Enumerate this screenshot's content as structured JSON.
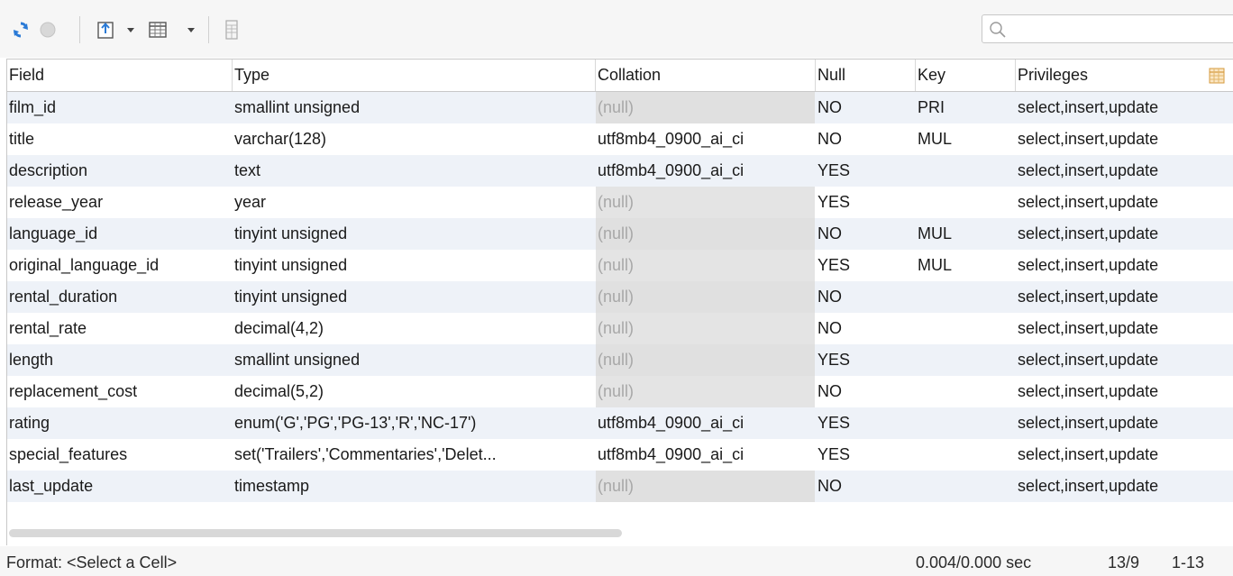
{
  "toolbar": {
    "search_placeholder": "",
    "icons": [
      "refresh-icon",
      "stop-icon",
      "export-icon",
      "dropdown-arrow-icon",
      "grid-view-icon",
      "dropdown-arrow-icon",
      "form-view-icon",
      "search-icon",
      "column-chooser-icon"
    ]
  },
  "grid": {
    "columns": [
      "Field",
      "Type",
      "Collation",
      "Null",
      "Key",
      "Privileges"
    ],
    "rows": [
      {
        "field": "film_id",
        "type": "smallint unsigned",
        "collation": "(null)",
        "null": "NO",
        "key": "PRI",
        "privileges": "select,insert,update"
      },
      {
        "field": "title",
        "type": "varchar(128)",
        "collation": "utf8mb4_0900_ai_ci",
        "null": "NO",
        "key": "MUL",
        "privileges": "select,insert,update"
      },
      {
        "field": "description",
        "type": "text",
        "collation": "utf8mb4_0900_ai_ci",
        "null": "YES",
        "key": "",
        "privileges": "select,insert,update"
      },
      {
        "field": "release_year",
        "type": "year",
        "collation": "(null)",
        "null": "YES",
        "key": "",
        "privileges": "select,insert,update"
      },
      {
        "field": "language_id",
        "type": "tinyint unsigned",
        "collation": "(null)",
        "null": "NO",
        "key": "MUL",
        "privileges": "select,insert,update"
      },
      {
        "field": "original_language_id",
        "type": "tinyint unsigned",
        "collation": "(null)",
        "null": "YES",
        "key": "MUL",
        "privileges": "select,insert,update"
      },
      {
        "field": "rental_duration",
        "type": "tinyint unsigned",
        "collation": "(null)",
        "null": "NO",
        "key": "",
        "privileges": "select,insert,update"
      },
      {
        "field": "rental_rate",
        "type": "decimal(4,2)",
        "collation": "(null)",
        "null": "NO",
        "key": "",
        "privileges": "select,insert,update"
      },
      {
        "field": "length",
        "type": "smallint unsigned",
        "collation": "(null)",
        "null": "YES",
        "key": "",
        "privileges": "select,insert,update"
      },
      {
        "field": "replacement_cost",
        "type": "decimal(5,2)",
        "collation": "(null)",
        "null": "NO",
        "key": "",
        "privileges": "select,insert,update"
      },
      {
        "field": "rating",
        "type": "enum('G','PG','PG-13','R','NC-17')",
        "collation": "utf8mb4_0900_ai_ci",
        "null": "YES",
        "key": "",
        "privileges": "select,insert,update"
      },
      {
        "field": "special_features",
        "type": "set('Trailers','Commentaries','Delet...",
        "collation": "utf8mb4_0900_ai_ci",
        "null": "YES",
        "key": "",
        "privileges": "select,insert,update"
      },
      {
        "field": "last_update",
        "type": "timestamp",
        "collation": "(null)",
        "null": "NO",
        "key": "",
        "privileges": "select,insert,update"
      }
    ]
  },
  "status": {
    "format": "Format: <Select a Cell>",
    "timing": "0.004/0.000 sec",
    "counts": "13/9",
    "range": "1-13"
  },
  "colors": {
    "alt_row": "#eef2f8",
    "null_cell_bg": "#e4e4e4",
    "null_text": "#a8a8a8",
    "refresh_icon": "#2a7ad6"
  }
}
